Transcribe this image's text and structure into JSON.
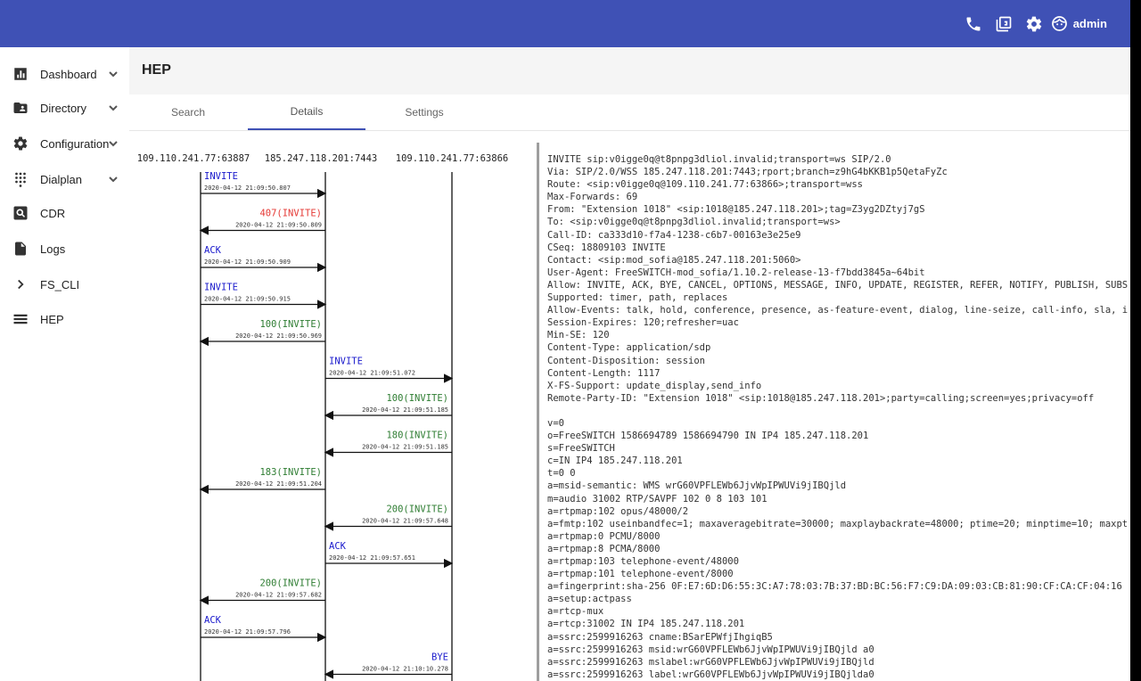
{
  "header": {
    "user": "admin",
    "icons": [
      "phone-icon",
      "clipboard-icon",
      "gear-icon",
      "user-face-icon"
    ]
  },
  "sidebar": {
    "items": [
      {
        "label": "Dashboard",
        "icon": "bar-chart-icon",
        "expandable": true
      },
      {
        "label": "Directory",
        "icon": "folder-user-icon",
        "expandable": true
      },
      {
        "label": "Configuration",
        "icon": "gear-icon",
        "expandable": true
      },
      {
        "label": "Dialplan",
        "icon": "dialpad-icon",
        "expandable": true
      },
      {
        "label": "CDR",
        "icon": "search-doc-icon",
        "expandable": false
      },
      {
        "label": "Logs",
        "icon": "document-icon",
        "expandable": false
      },
      {
        "label": "FS_CLI",
        "icon": "chevron-right-icon",
        "expandable": false
      },
      {
        "label": "HEP",
        "icon": "list-icon",
        "expandable": false
      }
    ]
  },
  "page": {
    "title": "HEP",
    "tabs": [
      {
        "label": "Search",
        "active": false
      },
      {
        "label": "Details",
        "active": true
      },
      {
        "label": "Settings",
        "active": false
      }
    ]
  },
  "flow": {
    "hosts": [
      "109.110.241.77:63887",
      "185.247.118.201:7443",
      "109.110.241.77:63866"
    ],
    "messages": [
      {
        "label": "INVITE",
        "time": "2020-04-12 21:09:50.807",
        "from": 0,
        "to": 1,
        "kind": "request"
      },
      {
        "label": "407(INVITE)",
        "time": "2020-04-12 21:09:50.809",
        "from": 1,
        "to": 0,
        "kind": "error"
      },
      {
        "label": "ACK",
        "time": "2020-04-12 21:09:50.909",
        "from": 0,
        "to": 1,
        "kind": "request"
      },
      {
        "label": "INVITE",
        "time": "2020-04-12 21:09:50.915",
        "from": 0,
        "to": 1,
        "kind": "request"
      },
      {
        "label": "100(INVITE)",
        "time": "2020-04-12 21:09:50.969",
        "from": 1,
        "to": 0,
        "kind": "ok"
      },
      {
        "label": "INVITE",
        "time": "2020-04-12 21:09:51.072",
        "from": 1,
        "to": 2,
        "kind": "request"
      },
      {
        "label": "100(INVITE)",
        "time": "2020-04-12 21:09:51.185",
        "from": 2,
        "to": 1,
        "kind": "ok"
      },
      {
        "label": "180(INVITE)",
        "time": "2020-04-12 21:09:51.185",
        "from": 2,
        "to": 1,
        "kind": "ok"
      },
      {
        "label": "183(INVITE)",
        "time": "2020-04-12 21:09:51.204",
        "from": 1,
        "to": 0,
        "kind": "ok"
      },
      {
        "label": "200(INVITE)",
        "time": "2020-04-12 21:09:57.648",
        "from": 2,
        "to": 1,
        "kind": "ok"
      },
      {
        "label": "ACK",
        "time": "2020-04-12 21:09:57.651",
        "from": 1,
        "to": 2,
        "kind": "request"
      },
      {
        "label": "200(INVITE)",
        "time": "2020-04-12 21:09:57.682",
        "from": 1,
        "to": 0,
        "kind": "ok"
      },
      {
        "label": "ACK",
        "time": "2020-04-12 21:09:57.796",
        "from": 0,
        "to": 1,
        "kind": "request"
      },
      {
        "label": "BYE",
        "time": "2020-04-12 21:10:10.278",
        "from": 2,
        "to": 1,
        "kind": "request"
      }
    ]
  },
  "colors": {
    "request": "#1a1acc",
    "error": "#e53935",
    "ok": "#2e7d32",
    "accent": "#3f51b5"
  },
  "raw_message": [
    "INVITE sip:v0igge0q@t8pnpg3dliol.invalid;transport=ws SIP/2.0",
    "Via: SIP/2.0/WSS 185.247.118.201:7443;rport;branch=z9hG4bKKB1p5QetaFyZc",
    "Route: <sip:v0igge0q@109.110.241.77:63866>;transport=wss",
    "Max-Forwards: 69",
    "From: \"Extension 1018\" <sip:1018@185.247.118.201>;tag=Z3yg2DZtyj7gS",
    "To: <sip:v0igge0q@t8pnpg3dliol.invalid;transport=ws>",
    "Call-ID: ca333d10-f7a4-1238-c6b7-00163e3e25e9",
    "CSeq: 18809103 INVITE",
    "Contact: <sip:mod_sofia@185.247.118.201:5060>",
    "User-Agent: FreeSWITCH-mod_sofia/1.10.2-release-13-f7bdd3845a~64bit",
    "Allow: INVITE, ACK, BYE, CANCEL, OPTIONS, MESSAGE, INFO, UPDATE, REGISTER, REFER, NOTIFY, PUBLISH, SUBS",
    "Supported: timer, path, replaces",
    "Allow-Events: talk, hold, conference, presence, as-feature-event, dialog, line-seize, call-info, sla, i",
    "Session-Expires: 120;refresher=uac",
    "Min-SE: 120",
    "Content-Type: application/sdp",
    "Content-Disposition: session",
    "Content-Length: 1117",
    "X-FS-Support: update_display,send_info",
    "Remote-Party-ID: \"Extension 1018\" <sip:1018@185.247.118.201>;party=calling;screen=yes;privacy=off",
    "",
    "v=0",
    "o=FreeSWITCH 1586694789 1586694790 IN IP4 185.247.118.201",
    "s=FreeSWITCH",
    "c=IN IP4 185.247.118.201",
    "t=0 0",
    "a=msid-semantic: WMS wrG60VPFLEWb6JjvWpIPWUVi9jIBQjld",
    "m=audio 31002 RTP/SAVPF 102 0 8 103 101",
    "a=rtpmap:102 opus/48000/2",
    "a=fmtp:102 useinbandfec=1; maxaveragebitrate=30000; maxplaybackrate=48000; ptime=20; minptime=10; maxpt",
    "a=rtpmap:0 PCMU/8000",
    "a=rtpmap:8 PCMA/8000",
    "a=rtpmap:103 telephone-event/48000",
    "a=rtpmap:101 telephone-event/8000",
    "a=fingerprint:sha-256 0F:E7:6D:D6:55:3C:A7:78:03:7B:37:BD:BC:56:F7:C9:DA:09:03:CB:81:90:CF:CA:CF:04:16",
    "a=setup:actpass",
    "a=rtcp-mux",
    "a=rtcp:31002 IN IP4 185.247.118.201",
    "a=ssrc:2599916263 cname:BSarEPWfjIhgiqB5",
    "a=ssrc:2599916263 msid:wrG60VPFLEWb6JjvWpIPWUVi9jIBQjld a0",
    "a=ssrc:2599916263 mslabel:wrG60VPFLEWb6JjvWpIPWUVi9jIBQjld",
    "a=ssrc:2599916263 label:wrG60VPFLEWb6JjvWpIPWUVi9jIBQjlda0"
  ]
}
